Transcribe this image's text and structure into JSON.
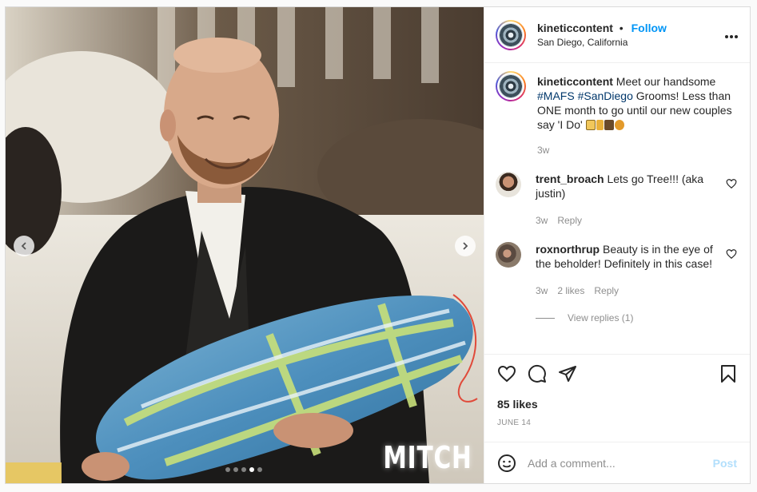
{
  "post": {
    "image": {
      "overlay_text": "MITCH",
      "carousel": {
        "count": 5,
        "active_index": 3
      },
      "prev_icon": "chevron-left-icon",
      "next_icon": "chevron-right-icon"
    },
    "header": {
      "username": "kineticcontent",
      "separator": "•",
      "follow_label": "Follow",
      "location": "San Diego, California",
      "more_icon": "more-options-icon"
    },
    "caption": {
      "username": "kineticcontent",
      "text_before": "Meet our handsome ",
      "hashtag1": "#MAFS",
      "hashtag2": "#SanDiego",
      "text_after": " Grooms! Less than ONE month to go until our new couples say 'I Do' ",
      "time": "3w"
    },
    "comments": [
      {
        "username": "trent_broach",
        "text": "Lets go Tree!!! (aka justin)",
        "time": "3w",
        "reply_label": "Reply"
      },
      {
        "username": "roxnorthrup",
        "text": "Beauty is in the eye of the beholder! Definitely in this case!",
        "time": "3w",
        "likes": "2 likes",
        "reply_label": "Reply",
        "view_replies": "View replies (1)"
      }
    ],
    "actions": {
      "like_icon": "heart-icon",
      "comment_icon": "comment-icon",
      "share_icon": "paper-plane-icon",
      "save_icon": "bookmark-icon"
    },
    "likes_text": "85 likes",
    "date_text": "JUNE 14",
    "add_comment": {
      "emoji_icon": "emoji-icon",
      "placeholder": "Add a comment...",
      "post_label": "Post"
    }
  },
  "colors": {
    "link": "#0095f6",
    "hashtag": "#00376b",
    "muted": "#8e8e8e",
    "post_disabled": "#b2dffc"
  }
}
